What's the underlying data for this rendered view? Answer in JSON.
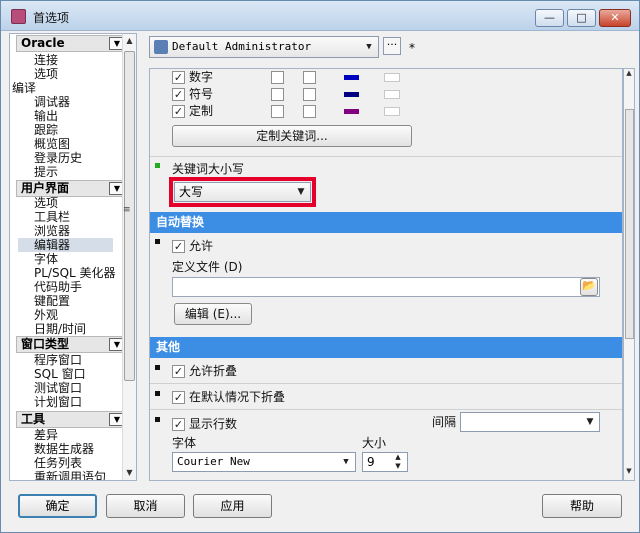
{
  "window": {
    "title": "首选项",
    "min": "—",
    "max": "□",
    "close": "✕"
  },
  "sidebar": {
    "groups": [
      {
        "label": "Oracle",
        "items": [
          "连接",
          "选项",
          "编译",
          "调试器",
          "输出",
          "跟踪",
          "概览图",
          "登录历史",
          "提示"
        ]
      },
      {
        "label": "用户界面",
        "items": [
          "选项",
          "工具栏",
          "浏览器",
          "编辑器",
          "字体",
          "PL/SQL 美化器",
          "代码助手",
          "键配置",
          "外观",
          "日期/时间"
        ]
      },
      {
        "label": "窗口类型",
        "items": [
          "程序窗口",
          "SQL 窗口",
          "测试窗口",
          "计划窗口"
        ]
      },
      {
        "label": "工具",
        "items": [
          "差异",
          "数据生成器",
          "任务列表",
          "重新调用语句"
        ]
      }
    ],
    "selected": "编辑器"
  },
  "profile": {
    "value": "Default Administrator",
    "dots": "···",
    "modified": "*"
  },
  "syntax": {
    "rows": [
      {
        "label": "数字",
        "checked": true,
        "color": "#0000c0"
      },
      {
        "label": "符号",
        "checked": true,
        "color": "#000080"
      },
      {
        "label": "定制",
        "checked": true,
        "color": "#800080"
      }
    ],
    "custom_keywords_button": "定制关键词..."
  },
  "keyword_case": {
    "label": "关键词大小写",
    "value": "大写"
  },
  "autoreplace": {
    "header": "自动替换",
    "allow_label": "允许",
    "allow_checked": true,
    "file_label": "定义文件 (D)",
    "file_value": "",
    "edit_button": "编辑 (E)..."
  },
  "other": {
    "header": "其他",
    "allow_fold": "允许折叠",
    "fold_default": "在默认情况下折叠",
    "show_line_numbers": "显示行数",
    "interval_label": "间隔",
    "interval_value": "",
    "font_label": "字体",
    "font_value": "Courier New",
    "size_label": "大小",
    "size_value": "9"
  },
  "buttons": {
    "ok": "确定",
    "cancel": "取消",
    "apply": "应用",
    "help": "帮助"
  },
  "colors": {
    "section_header": "#3c8de4",
    "highlight_box": "#e4002b",
    "indicator": "#22aa22"
  }
}
